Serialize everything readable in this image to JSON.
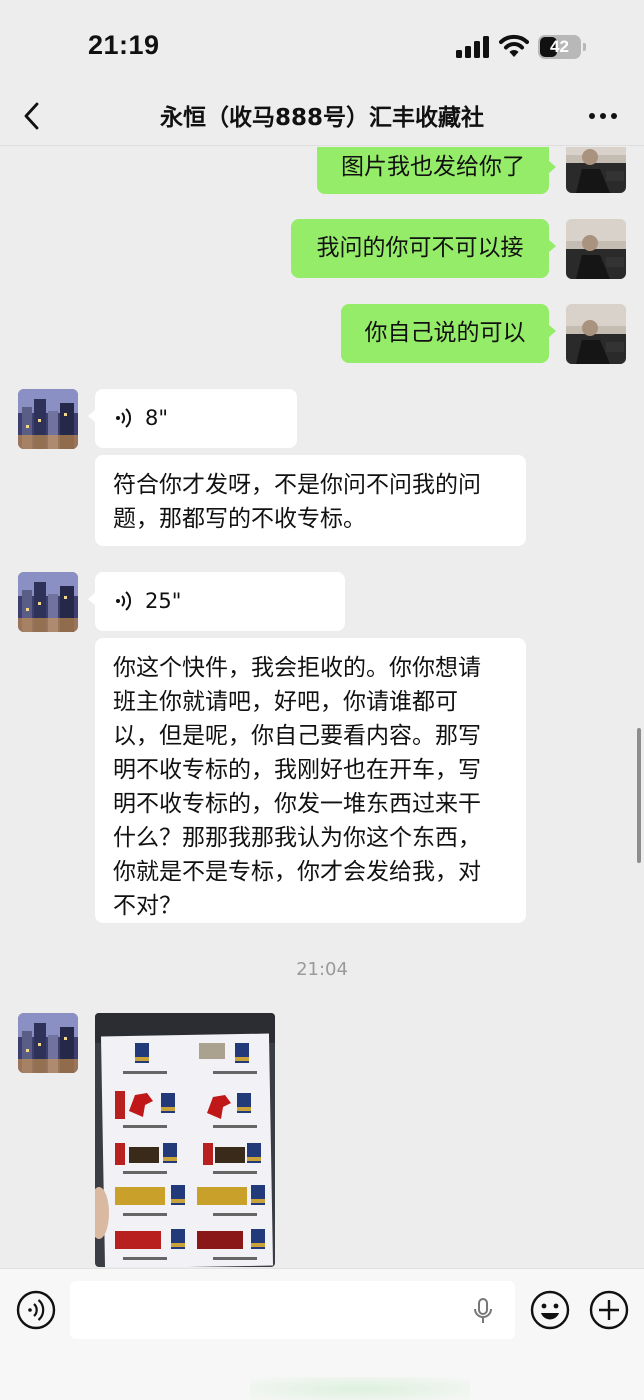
{
  "status_bar": {
    "time": "21:19",
    "battery": "42",
    "icons": [
      "cellular-signal-icon",
      "wifi-icon",
      "battery-icon"
    ]
  },
  "nav": {
    "title": "永恒（收马888号）汇丰收藏社",
    "back_icon": "chevron-left-icon",
    "more_icon": "more-dots-icon"
  },
  "messages": [
    {
      "side": "right",
      "type": "text",
      "text": "图片我也发给你了"
    },
    {
      "side": "right",
      "type": "text",
      "text": "我问的你可不可以接"
    },
    {
      "side": "right",
      "type": "text",
      "text": "你自己说的可以"
    },
    {
      "side": "left",
      "type": "voice",
      "duration": "8\""
    },
    {
      "side": "left",
      "type": "text",
      "lines": [
        "符合你才发呀，不是你问不问我的问",
        "题，那都写的不收专标。"
      ]
    },
    {
      "side": "left",
      "type": "voice",
      "duration": "25\""
    },
    {
      "side": "left",
      "type": "text",
      "lines": [
        "你这个快件，我会拒收的。你你想请",
        "班主你就请吧，好吧，你请谁都可",
        "以，但是呢，你自己要看内容。那写",
        "明不收专标的，我刚好也在开车，写",
        "明不收专标的，你发一堆东西过来干",
        "什么？那那我那我认为你这个东西，",
        "你就是不是专标，你才会发给我，对",
        "不对？"
      ]
    },
    {
      "side": "left",
      "type": "image",
      "image_icon": "catalog-photo"
    }
  ],
  "timestamp": "21:04",
  "input_bar": {
    "voice_icon": "voice-mode-icon",
    "mic_icon": "microphone-icon",
    "emoji_icon": "emoji-icon",
    "plus_icon": "plus-icon"
  }
}
